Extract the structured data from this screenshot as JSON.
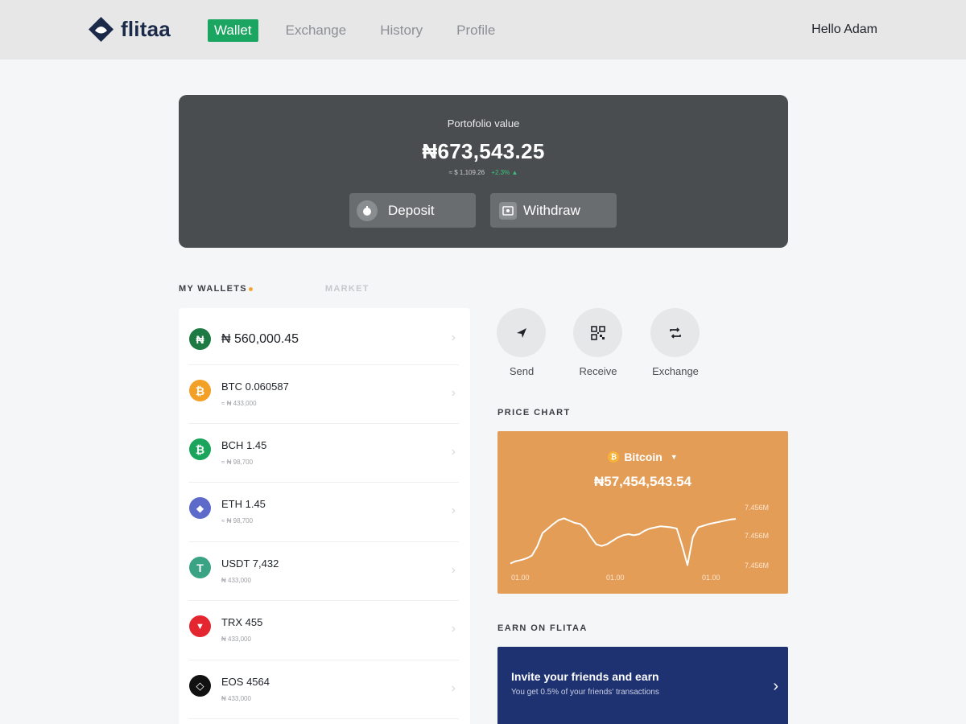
{
  "brand": {
    "name": "flitaa",
    "primary": "#1c2a4a",
    "accent": "#1aa560"
  },
  "nav": {
    "items": [
      {
        "label": "Wallet",
        "active": true
      },
      {
        "label": "Exchange",
        "active": false
      },
      {
        "label": "History",
        "active": false
      },
      {
        "label": "Profile",
        "active": false
      }
    ],
    "greeting": "Hello Adam"
  },
  "portfolio": {
    "label": "Portofolio value",
    "value": "₦673,543.25",
    "usd": "≈ $ 1,109.26",
    "change": "+2.3% ▲",
    "deposit_label": "Deposit",
    "withdraw_label": "Withdraw"
  },
  "tabs": {
    "wallets": "MY WALLETS",
    "market": "MARKET"
  },
  "wallets": [
    {
      "icon": "naira-icon",
      "symbol": "₦",
      "color": "#1d7a43",
      "name": "₦ 560,000.45",
      "sub": ""
    },
    {
      "icon": "bitcoin-icon",
      "symbol": "₿",
      "color": "#f3a026",
      "name": "BTC 0.060587",
      "sub": "≈ ₦ 433,000"
    },
    {
      "icon": "bitcoin-cash-icon",
      "symbol": "₿",
      "color": "#1ba55c",
      "name": "BCH 1.45",
      "sub": "≈ ₦ 98,700"
    },
    {
      "icon": "ethereum-icon",
      "symbol": "◆",
      "color": "#5e6ac9",
      "name": "ETH 1.45",
      "sub": "≈ ₦ 98,700"
    },
    {
      "icon": "tether-icon",
      "symbol": "T",
      "color": "#3aa384",
      "name": "USDT 7,432",
      "sub": "₦ 433,000"
    },
    {
      "icon": "tron-icon",
      "symbol": "▼",
      "color": "#e3262f",
      "name": "TRX 455",
      "sub": "₦ 433,000"
    },
    {
      "icon": "eos-icon",
      "symbol": "◇",
      "color": "#111111",
      "name": "EOS 4564",
      "sub": "₦ 433,000"
    }
  ],
  "actions": {
    "send": "Send",
    "receive": "Receive",
    "exchange": "Exchange"
  },
  "price_chart": {
    "section_title": "PRICE CHART",
    "coin": "Bitcoin",
    "price": "₦57,454,543.54",
    "background": "#e39d57"
  },
  "chart_data": {
    "type": "line",
    "x": [
      "01.00",
      "01.00",
      "01.00"
    ],
    "y_ticks": [
      "7.456M",
      "7.456M",
      "7.456M"
    ],
    "series": [
      {
        "values": [
          0.08,
          0.12,
          0.14,
          0.17,
          0.22,
          0.38,
          0.62,
          0.7,
          0.78,
          0.85,
          0.88,
          0.84,
          0.8,
          0.78,
          0.7,
          0.55,
          0.42,
          0.39,
          0.42,
          0.48,
          0.54,
          0.58,
          0.6,
          0.58,
          0.6,
          0.66,
          0.7,
          0.72,
          0.74,
          0.73,
          0.72,
          0.7,
          0.4,
          0.05,
          0.55,
          0.72,
          0.75,
          0.78,
          0.8,
          0.82,
          0.84,
          0.86,
          0.87
        ]
      }
    ]
  },
  "earn": {
    "section_title": "EARN ON FLITAA",
    "title": "Invite your friends and earn",
    "subtitle": "You get 0.5% of your friends' transactions"
  }
}
